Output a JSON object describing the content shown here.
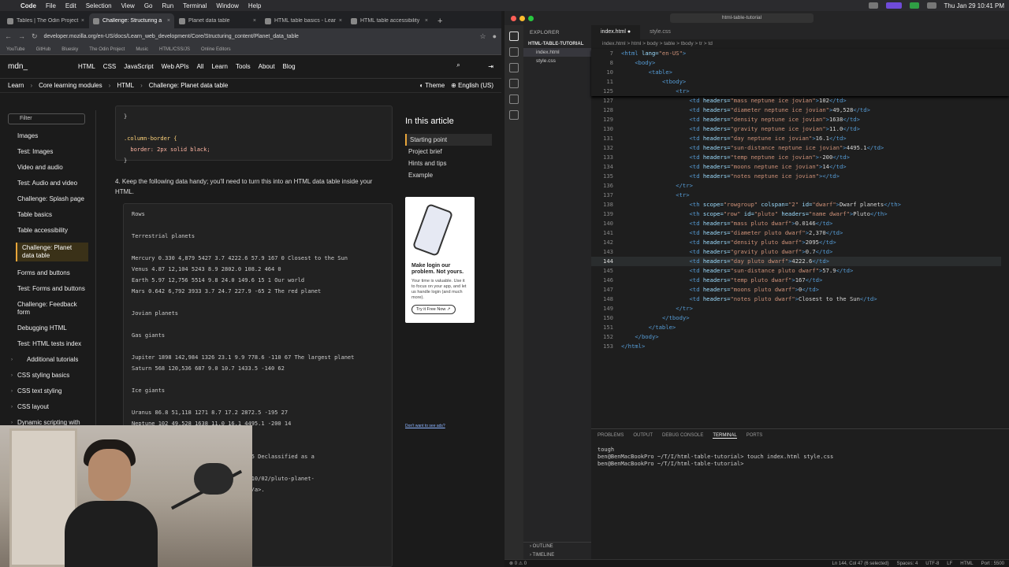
{
  "menubar": {
    "items": [
      "Code",
      "File",
      "Edit",
      "Selection",
      "View",
      "Go",
      "Run",
      "Terminal",
      "Window",
      "Help"
    ],
    "clock": "Thu Jan 29  10:41 PM"
  },
  "browser": {
    "tabs": [
      {
        "label": "Tables | The Odin Project",
        "active": false
      },
      {
        "label": "Challenge: Structuring a",
        "active": true
      },
      {
        "label": "Planet data table",
        "active": false
      },
      {
        "label": "HTML table basics - Lear",
        "active": false
      },
      {
        "label": "HTML table accessibility",
        "active": false
      }
    ],
    "url": "developer.mozilla.org/en-US/docs/Learn_web_development/Core/Structuring_content/Planet_data_table",
    "bookmarks": [
      "YouTube",
      "GitHub",
      "Bluesky",
      "The Odin Project",
      "Music",
      "HTML/CSS/JS",
      "Online Editors"
    ]
  },
  "mdn": {
    "logo": "mdn_",
    "nav": [
      "HTML",
      "CSS",
      "JavaScript",
      "Web APIs",
      "All",
      "Learn",
      "Tools",
      "About",
      "Blog"
    ],
    "breadcrumb": [
      "Learn",
      "Core learning modules",
      "HTML",
      "Challenge: Planet data table"
    ],
    "theme_label": "Theme",
    "language_label": "English (US)",
    "filter_placeholder": "Filter",
    "sidebar": [
      {
        "label": "Images"
      },
      {
        "label": "Test: Images"
      },
      {
        "label": "Video and audio"
      },
      {
        "label": "Test: Audio and video"
      },
      {
        "label": "Challenge: Splash page"
      },
      {
        "label": "Table basics"
      },
      {
        "label": "Table accessibility"
      },
      {
        "label": "Challenge: Planet data table",
        "active": true
      },
      {
        "label": "Forms and buttons"
      },
      {
        "label": "Test: Forms and buttons"
      },
      {
        "label": "Challenge: Feedback form"
      },
      {
        "label": "Debugging HTML"
      },
      {
        "label": "Test: HTML tests index"
      },
      {
        "label": "Additional tutorials",
        "sub": true
      },
      {
        "label": "CSS styling basics",
        "group": true
      },
      {
        "label": "CSS text styling",
        "group": true
      },
      {
        "label": "CSS layout",
        "group": true
      },
      {
        "label": "Dynamic scripting with",
        "group": true
      }
    ],
    "css_lines": [
      "}",
      "",
      ".column-border {",
      "  border: 2px solid black;",
      "}"
    ],
    "step4": "4. Keep the following data handy; you'll need to turn this into an HTML data table inside your HTML.",
    "data_lines": [
      "Rows",
      "",
      "Terrestrial planets",
      "",
      "Mercury 0.330 4,879 5427 3.7 4222.6 57.9 167 0 Closest to the Sun",
      "Venus 4.87 12,104 5243 8.9 2802.0 108.2 464 0",
      "Earth 5.97 12,756 5514 9.8 24.0 149.6 15 1 Our world",
      "Mars 0.642 6,792 3933 3.7 24.7 227.9 -65 2 The red planet",
      "",
      "Jovian planets",
      "",
      "Gas giants",
      "",
      "Jupiter 1898 142,984 1326 23.1 9.9 778.6 -110 67 The largest planet",
      "Saturn 568 120,536 687 9.0 10.7 1433.5 -140 62",
      "",
      "Ice giants",
      "",
      "Uranus 86.8 51,118 1271 8.7 17.2 2872.5 -195 27",
      "Neptune 102 49,528 1638 11.0 16.1 4495.1 -200 14",
      "",
      "",
      "                        5906.4 -225 5 Declassified as a",
      "",
      "                        y/tech/2014/10/02/pluto-planet-",
      "                        ntroversial</a>."
    ],
    "toc_title": "In this article",
    "toc": [
      {
        "label": "Starting point",
        "active": true
      },
      {
        "label": "Project brief"
      },
      {
        "label": "Hints and tips"
      },
      {
        "label": "Example"
      }
    ],
    "ad": {
      "title": "Make login our problem. Not yours.",
      "body": "Your time is valuable. Use it to focus on your app, and let us handle login (and much more).",
      "cta": "Try it Free Now ↗",
      "optout": "Don't want to see ads?"
    }
  },
  "vscode": {
    "title_search": "html-table-tutorial",
    "explorer_header": "EXPLORER",
    "project": "HTML-TABLE-TUTORIAL",
    "files": [
      {
        "name": "index.html",
        "active": true
      },
      {
        "name": "style.css",
        "active": false
      }
    ],
    "outline": [
      "OUTLINE",
      "TIMELINE"
    ],
    "tabs": [
      {
        "label": "index.html ●",
        "active": true
      },
      {
        "label": "style.css",
        "active": false
      }
    ],
    "breadcrumbs": "index.html > html > body > table > tbody > tr > td",
    "sticky": [
      {
        "n": "7",
        "indent": 0,
        "code": "<html lang=\"en-US\">"
      },
      {
        "n": "8",
        "indent": 1,
        "code": "<body>"
      },
      {
        "n": "10",
        "indent": 2,
        "code": "<table>"
      },
      {
        "n": "11",
        "indent": 3,
        "code": "<tbody>"
      },
      {
        "n": "125",
        "indent": 4,
        "code": "<tr>"
      }
    ],
    "lines": [
      {
        "n": "127",
        "indent": 5,
        "code": "<td headers=\"mass neptune ice jovian\">102</td>"
      },
      {
        "n": "128",
        "indent": 5,
        "code": "<td headers=\"diameter neptune ice jovian\">49,528</td>"
      },
      {
        "n": "129",
        "indent": 5,
        "code": "<td headers=\"density neptune ice jovian\">1638</td>"
      },
      {
        "n": "130",
        "indent": 5,
        "code": "<td headers=\"gravity neptune ice jovian\">11.0</td>"
      },
      {
        "n": "131",
        "indent": 5,
        "code": "<td headers=\"day neptune ice jovian\">16.1</td>"
      },
      {
        "n": "132",
        "indent": 5,
        "code": "<td headers=\"sun-distance neptune ice jovian\">4495.1</td>"
      },
      {
        "n": "133",
        "indent": 5,
        "code": "<td headers=\"temp neptune ice jovian\">-200</td>"
      },
      {
        "n": "134",
        "indent": 5,
        "code": "<td headers=\"moons neptune ice jovian\">14</td>"
      },
      {
        "n": "135",
        "indent": 5,
        "code": "<td headers=\"notes neptune ice jovian\"></td>"
      },
      {
        "n": "136",
        "indent": 4,
        "code": "</tr>"
      },
      {
        "n": "137",
        "indent": 4,
        "code": "<tr>"
      },
      {
        "n": "138",
        "indent": 5,
        "code": "<th scope=\"rowgroup\" colspan=\"2\" id=\"dwarf\">Dwarf planets</th>"
      },
      {
        "n": "139",
        "indent": 5,
        "code": "<th scope=\"row\" id=\"pluto\" headers=\"name dwarf\">Pluto</th>"
      },
      {
        "n": "140",
        "indent": 5,
        "code": "<td headers=\"mass pluto dwarf\">0.0146</td>"
      },
      {
        "n": "141",
        "indent": 5,
        "code": "<td headers=\"diameter pluto dwarf\">2,370</td>"
      },
      {
        "n": "142",
        "indent": 5,
        "code": "<td headers=\"density pluto dwarf\">2095</td>"
      },
      {
        "n": "143",
        "indent": 5,
        "code": "<td headers=\"gravity pluto dwarf\">0.7</td>"
      },
      {
        "n": "144",
        "indent": 5,
        "code": "<td headers=\"day pluto dwarf\">4222.6</td>",
        "current": true
      },
      {
        "n": "145",
        "indent": 5,
        "code": "<td headers=\"sun-distance pluto dwarf\">57.9</td>"
      },
      {
        "n": "146",
        "indent": 5,
        "code": "<td headers=\"temp pluto dwarf\">167</td>"
      },
      {
        "n": "147",
        "indent": 5,
        "code": "<td headers=\"moons pluto dwarf\">0</td>"
      },
      {
        "n": "148",
        "indent": 5,
        "code": "<td headers=\"notes pluto dwarf\">Closest to the Sun</td>"
      },
      {
        "n": "149",
        "indent": 4,
        "code": "</tr>"
      },
      {
        "n": "150",
        "indent": 3,
        "code": "</tbody>"
      },
      {
        "n": "151",
        "indent": 2,
        "code": "</table>"
      },
      {
        "n": "152",
        "indent": 1,
        "code": "</body>"
      },
      {
        "n": "153",
        "indent": 0,
        "code": "</html>"
      }
    ],
    "panel_tabs": [
      {
        "label": "PROBLEMS"
      },
      {
        "label": "OUTPUT"
      },
      {
        "label": "DEBUG CONSOLE"
      },
      {
        "label": "TERMINAL",
        "active": true
      },
      {
        "label": "PORTS"
      }
    ],
    "terminal": [
      "tough",
      "ben@BenMacBookPro ~/T/I/html-table-tutorial> touch index.html style.css",
      "ben@BenMacBookPro ~/T/I/html-table-tutorial> "
    ],
    "status_left": "⊗ 0 ⚠ 0",
    "status_right": [
      "Ln 144, Col 47 (6 selected)",
      "Spaces: 4",
      "UTF-8",
      "LF",
      "HTML",
      "Port : 5500"
    ]
  }
}
